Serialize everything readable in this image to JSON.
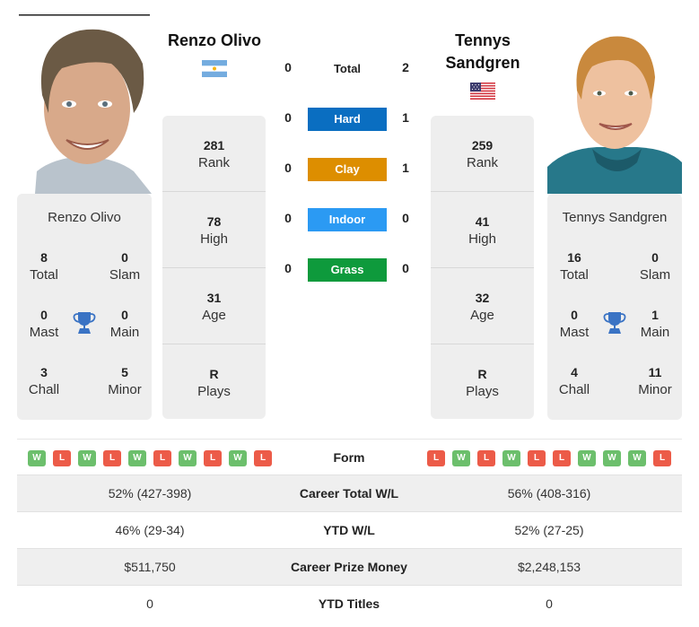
{
  "player1": {
    "name": "Renzo Olivo",
    "country": "Argentina",
    "flag_icon": "argentina-flag-icon",
    "rank": "281",
    "rank_label": "Rank",
    "high": "78",
    "high_label": "High",
    "age": "31",
    "age_label": "Age",
    "plays": "R",
    "plays_label": "Plays",
    "titles": {
      "total": "8",
      "total_label": "Total",
      "slam": "0",
      "slam_label": "Slam",
      "mast": "0",
      "mast_label": "Mast",
      "main": "0",
      "main_label": "Main",
      "chall": "3",
      "chall_label": "Chall",
      "minor": "5",
      "minor_label": "Minor"
    },
    "form": [
      "W",
      "L",
      "W",
      "L",
      "W",
      "L",
      "W",
      "L",
      "W",
      "L"
    ]
  },
  "player2": {
    "name": "Tennys Sandgren",
    "name_line1": "Tennys",
    "name_line2": "Sandgren",
    "country": "USA",
    "flag_icon": "usa-flag-icon",
    "rank": "259",
    "rank_label": "Rank",
    "high": "41",
    "high_label": "High",
    "age": "32",
    "age_label": "Age",
    "plays": "R",
    "plays_label": "Plays",
    "titles": {
      "total": "16",
      "total_label": "Total",
      "slam": "0",
      "slam_label": "Slam",
      "mast": "0",
      "mast_label": "Mast",
      "main": "1",
      "main_label": "Main",
      "chall": "4",
      "chall_label": "Chall",
      "minor": "11",
      "minor_label": "Minor"
    },
    "form": [
      "L",
      "W",
      "L",
      "W",
      "L",
      "L",
      "W",
      "W",
      "W",
      "L"
    ]
  },
  "h2h": {
    "total_label": "Total",
    "total": {
      "p1": "0",
      "p2": "2"
    },
    "surfaces": [
      {
        "label": "Hard",
        "p1": "0",
        "p2": "1",
        "color": "#0a6ec1"
      },
      {
        "label": "Clay",
        "p1": "0",
        "p2": "1",
        "color": "#dd8e00"
      },
      {
        "label": "Indoor",
        "p1": "0",
        "p2": "0",
        "color": "#2b9af3"
      },
      {
        "label": "Grass",
        "p1": "0",
        "p2": "0",
        "color": "#0e9a3c"
      }
    ]
  },
  "comparison": {
    "form_label": "Form",
    "rows": [
      {
        "label": "Career Total W/L",
        "p1": "52% (427-398)",
        "p2": "56% (408-316)"
      },
      {
        "label": "YTD W/L",
        "p1": "46% (29-34)",
        "p2": "52% (27-25)"
      },
      {
        "label": "Career Prize Money",
        "p1": "$511,750",
        "p2": "$2,248,153"
      },
      {
        "label": "YTD Titles",
        "p1": "0",
        "p2": "0"
      }
    ]
  },
  "colors": {
    "win": "#6cbf6c",
    "loss": "#ec5b48",
    "trophy": "#3a73c4",
    "panel": "#eeeeee"
  }
}
